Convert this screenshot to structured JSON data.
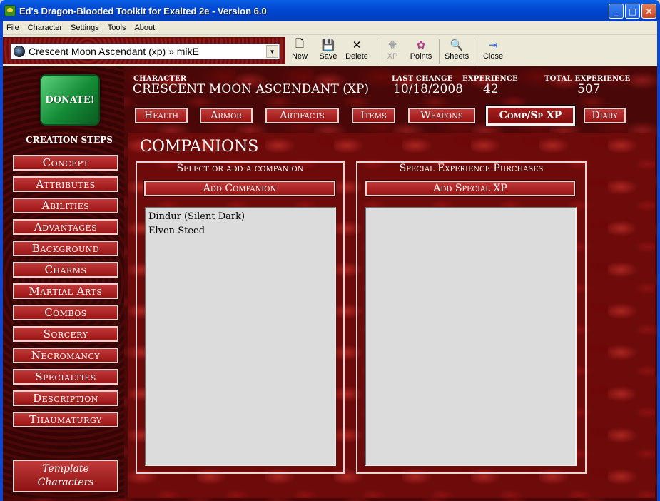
{
  "window": {
    "title": "Ed's Dragon-Blooded Toolkit for Exalted 2e - Version 6.0",
    "minimize_glyph": "_",
    "maximize_glyph": "□",
    "close_glyph": "✕"
  },
  "menu": {
    "items": [
      "File",
      "Character",
      "Settings",
      "Tools",
      "About"
    ]
  },
  "toolbar": {
    "character_select": "Crescent Moon Ascendant (xp) » mikE",
    "dropdown_glyph": "▼",
    "buttons": [
      {
        "label": "New",
        "icon": "new-document-icon",
        "glyph": "🗋"
      },
      {
        "label": "Save",
        "icon": "floppy-disk-icon",
        "glyph": "💾"
      },
      {
        "label": "Delete",
        "icon": "x-delete-icon",
        "glyph": "✕"
      },
      {
        "label": "XP",
        "icon": "xp-icon",
        "glyph": "✺"
      },
      {
        "label": "Points",
        "icon": "points-icon",
        "glyph": "✿"
      },
      {
        "label": "Sheets",
        "icon": "sheets-magnifier-icon",
        "glyph": "🔍"
      },
      {
        "label": "Close",
        "icon": "exit-door-icon",
        "glyph": "⇥"
      }
    ]
  },
  "sidebar": {
    "donate_label": "DONATE!",
    "steps_title": "CREATION STEPS",
    "steps": [
      "Concept",
      "Attributes",
      "Abilities",
      "Advantages",
      "Background",
      "Charms",
      "Martial Arts",
      "Combos",
      "Sorcery",
      "Necromancy",
      "Specialties",
      "Description",
      "Thaumaturgy"
    ],
    "template_line1": "Template",
    "template_line2": "Characters"
  },
  "header": {
    "character_label": "CHARACTER",
    "character_name": "CRESCENT MOON ASCENDANT (XP)",
    "last_change_label": "LAST CHANGE",
    "last_change_value": "10/18/2008",
    "experience_label": "EXPERIENCE",
    "experience_value": "42",
    "total_experience_label": "TOTAL EXPERIENCE",
    "total_experience_value": "507"
  },
  "tabs": [
    "Health",
    "Armor",
    "Artifacts",
    "Items",
    "Weapons",
    "Comp/Sp XP",
    "Diary"
  ],
  "active_tab": "Comp/Sp XP",
  "companions": {
    "section_title": "COMPANIONS",
    "select_title": "Select or add a companion",
    "add_button": "Add Companion",
    "list": [
      "Dindur (Silent Dark)",
      "Elven Steed"
    ],
    "special_title": "Special Experience Purchases",
    "add_special_button": "Add Special XP"
  }
}
